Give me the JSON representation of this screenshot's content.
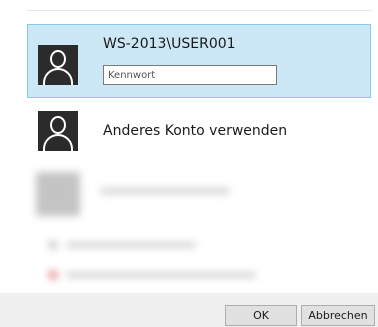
{
  "accounts": [
    {
      "name": "WS-2013\\USER001"
    }
  ],
  "password": {
    "placeholder": "Kennwort",
    "value": ""
  },
  "alternate_account": {
    "label": "Anderes Konto verwenden"
  },
  "footer": {
    "ok_label": "OK",
    "cancel_label": "Abbrechen"
  },
  "icons": {
    "avatar": "user-silhouette-icon"
  },
  "colors": {
    "selected_tile": "#cce8f7",
    "selected_border": "#8ac8ec",
    "avatar_bg": "#2b2b2b",
    "footer_bg": "#f0f0f0"
  }
}
